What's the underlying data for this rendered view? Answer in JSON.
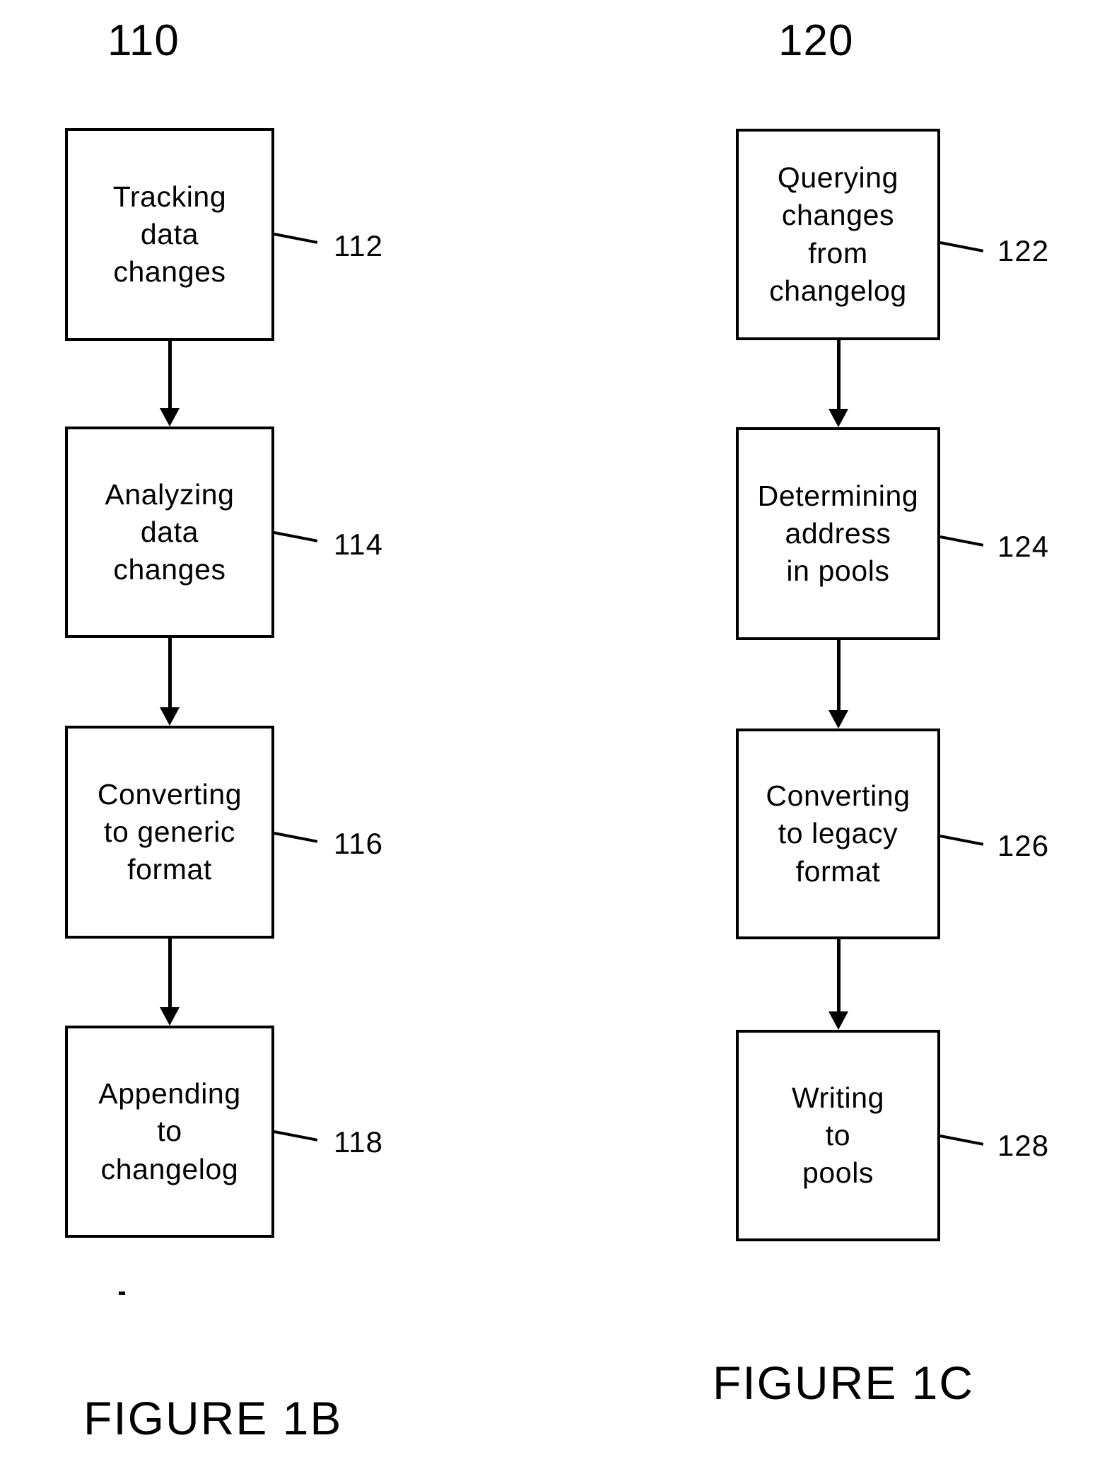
{
  "figures": [
    {
      "group_number": "110",
      "caption": "FIGURE 1B",
      "steps": [
        {
          "text": "Tracking\ndata\nchanges",
          "ref": "112"
        },
        {
          "text": "Analyzing\ndata\nchanges",
          "ref": "114"
        },
        {
          "text": "Converting\nto generic\nformat",
          "ref": "116"
        },
        {
          "text": "Appending\nto\nchangelog",
          "ref": "118"
        }
      ]
    },
    {
      "group_number": "120",
      "caption": "FIGURE 1C",
      "steps": [
        {
          "text": "Querying\nchanges\nfrom\nchangelog",
          "ref": "122"
        },
        {
          "text": "Determining\naddress\nin pools",
          "ref": "124"
        },
        {
          "text": "Converting\nto legacy\nformat",
          "ref": "126"
        },
        {
          "text": "Writing\nto\npools",
          "ref": "128"
        }
      ]
    }
  ],
  "colors": {
    "ink": "#000000",
    "paper": "#ffffff"
  }
}
